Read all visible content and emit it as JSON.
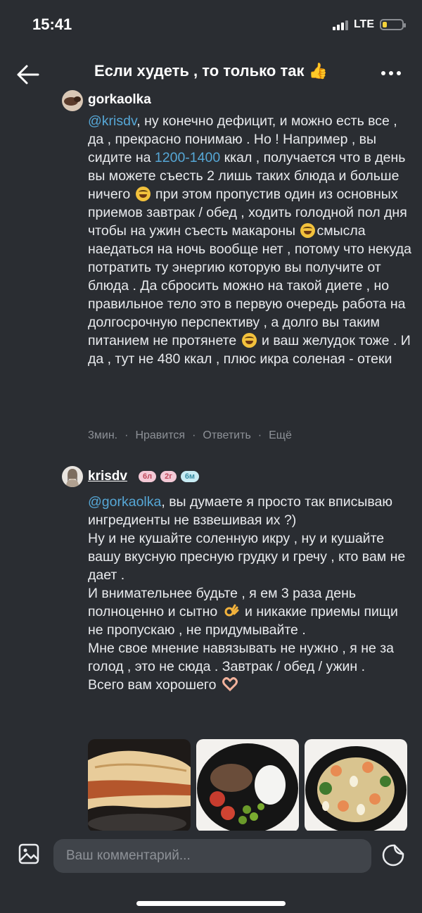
{
  "status": {
    "time": "15:41",
    "network": "LTE"
  },
  "header": {
    "title": "Если худеть , то только так 👍"
  },
  "comments": [
    {
      "username": "gorkaolka",
      "text": {
        "mention": "@krisdv",
        "p1": ", ну конечно дефицит, и можно есть все , да , прекрасно понимаю . Но ! Например , вы сидите на ",
        "num": "1200-1400",
        "p2": " ккал , получается что в день вы можете съесть 2 лишь таких блюда и больше ничего ",
        "p3": " при этом пропустив один из основных приемов завтрак / обед , ходить голодной пол дня чтобы на ужин съесть макароны ",
        "p4": "смысла наедаться на ночь вообще нет , потому что некуда потратить ту энергию которую вы получите от блюда . Да сбросить можно на такой диете , но правильное тело это в первую очередь работа на долгосрочную перспективу , а долго вы таким питанием не протянете ",
        "p5": " и ваш желудок тоже . И да , тут не 480 ккал , плюс икра соленая - отеки"
      },
      "time": "3мин.",
      "like": "Нравится",
      "reply": "Ответить",
      "more": "Ещё"
    },
    {
      "username": "krisdv",
      "badges": [
        "6л",
        "2г",
        "6м"
      ],
      "text": {
        "mention": "@gorkaolka",
        "p1": ", вы думаете я просто так вписываю ингредиенты не взвешивая их ?)",
        "p2": "Ну и не кушайте соленную икру , ну и кушайте вашу вкусную пресную грудку и гречу , кто вам не дает .",
        "p3": "И внимательнее будьте , я ем 3 раза день полноценно и сытно ",
        "p4": " и никакие приемы пищи не пропускаю , не придумывайте .",
        "p5": "Мне свое мнение навязывать не нужно , я не за голод , это не сюда . Завтрак / обед / ужин .",
        "p6": "Всего вам хорошего "
      }
    }
  ],
  "composer": {
    "placeholder": "Ваш комментарий..."
  },
  "colors": {
    "background": "#2a2d32",
    "accent": "#56a7d6",
    "muted": "#8d9197"
  },
  "icons": [
    "back-arrow-icon",
    "more-dots-icon",
    "laughing-emoji-icon",
    "ok-hand-emoji-icon",
    "heart-hands-emoji-icon",
    "image-attach-icon",
    "sticker-icon"
  ]
}
